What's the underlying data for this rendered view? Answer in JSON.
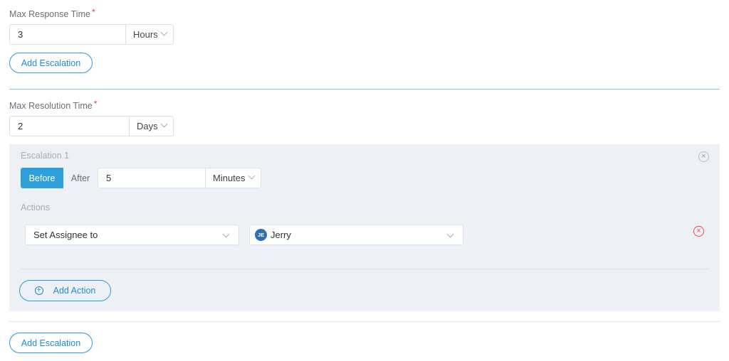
{
  "response_time": {
    "label": "Max Response Time",
    "required_mark": "*",
    "value": "3",
    "unit": "Hours",
    "add_escalation_label": "Add Escalation"
  },
  "resolution_time": {
    "label": "Max Resolution Time",
    "required_mark": "*",
    "value": "2",
    "unit": "Days",
    "escalation": {
      "title": "Escalation 1",
      "timing_options": [
        "Before",
        "After"
      ],
      "selected_timing": "Before",
      "amount": "5",
      "unit": "Minutes",
      "actions_label": "Actions",
      "action_type": "Set Assignee to",
      "assignee": {
        "initials": "JE",
        "name": "Jerry"
      },
      "add_action_label": "Add Action",
      "remove_escalation_icon": "close-circle-icon",
      "remove_action_icon": "close-circle-icon"
    },
    "add_escalation_label": "Add Escalation"
  },
  "colors": {
    "accent": "#2d9fd9",
    "danger": "#e74c4c",
    "panel_bg": "#edf0f4",
    "divider_accent": "#8fc6d8",
    "divider_plain": "#e3e6ea"
  }
}
